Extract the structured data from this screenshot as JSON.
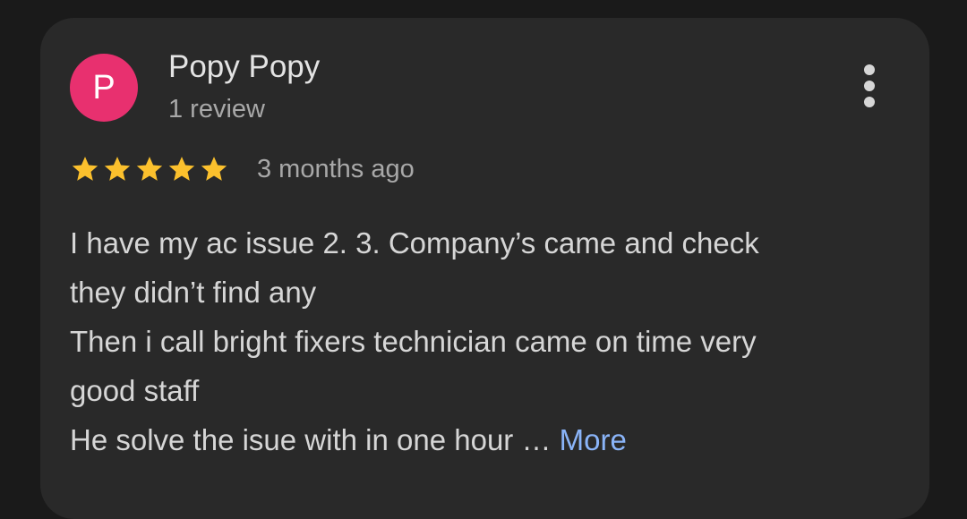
{
  "review": {
    "author": {
      "initial": "P",
      "name": "Popy Popy",
      "review_count": "1 review",
      "avatar_color": "#e8306f"
    },
    "rating": 5,
    "rating_max": 5,
    "time_ago": "3 months ago",
    "text_lines": [
      "I have my ac issue 2. 3. Company’s came and check",
      "they didn’t find any",
      "Then i call bright fixers technician came on time very",
      "good staff",
      "He solve the isue with in one hour …"
    ],
    "more_label": "More",
    "more_options_icon": "more-vert-icon"
  },
  "colors": {
    "background": "#1a1a1a",
    "card": "#292929",
    "star": "#fbc02d",
    "link": "#8ab4f8"
  }
}
